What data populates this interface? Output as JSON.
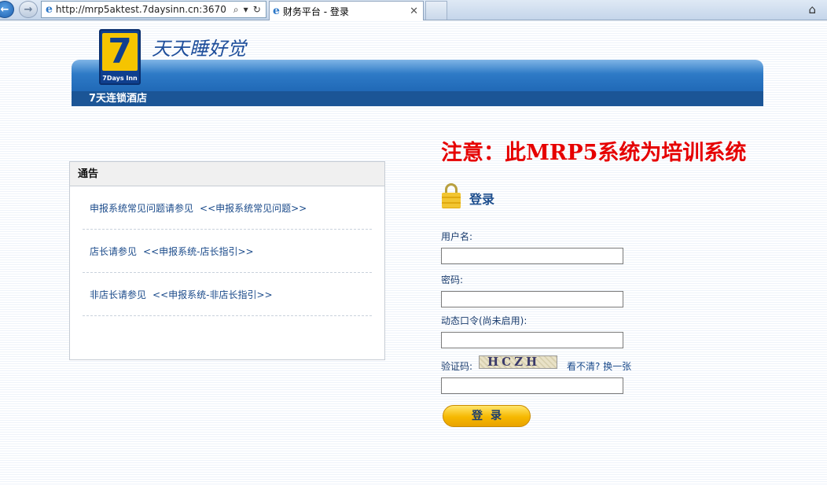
{
  "browser": {
    "url": "http://mrp5aktest.7daysinn.cn:3670",
    "tab_title": "财务平台 - 登录",
    "icons": [
      "back-icon",
      "forward-icon",
      "ie-icon",
      "search-icon",
      "dropdown-icon",
      "refresh-icon",
      "close-icon",
      "home-icon"
    ]
  },
  "header": {
    "logo_number": "7",
    "logo_text": "7Days Inn",
    "slogan": "天天睡好觉",
    "company_name": "7天连锁酒店"
  },
  "notice": {
    "title": "通告",
    "items": [
      {
        "text": "申报系统常见问题请参见",
        "link": "<<申报系统常见问题>>"
      },
      {
        "text": "店长请参见",
        "link": "<<申报系统-店长指引>>"
      },
      {
        "text": "非店长请参见",
        "link": "<<申报系统-非店长指引>>"
      }
    ]
  },
  "login": {
    "warning": "注意：此MRP5系统为培训系统",
    "title": "登录",
    "username_label": "用户名:",
    "username_value": "",
    "password_label": "密码:",
    "password_value": "",
    "otp_label": "动态口令(尚未启用):",
    "otp_value": "",
    "captcha_label": "验证码:",
    "captcha_text": "HCZH",
    "captcha_refresh": "看不清? 换一张",
    "captcha_value": "",
    "submit_label": "登录"
  },
  "colors": {
    "brand_blue": "#2069b7",
    "brand_dark_blue": "#1b5596",
    "logo_yellow": "#f5c400",
    "warning_red": "#e60000",
    "button_yellow": "#f6b800"
  }
}
